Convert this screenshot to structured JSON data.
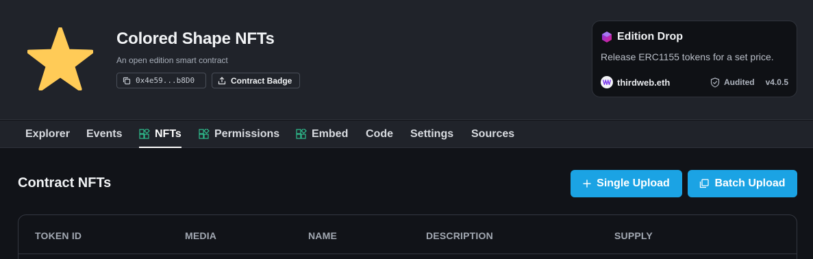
{
  "contract": {
    "name": "Colored Shape NFTs",
    "description": "An open edition smart contract",
    "address": "0x4e59...b8D0",
    "badge_label": "Contract Badge"
  },
  "card": {
    "title": "Edition Drop",
    "description": "Release ERC1155 tokens for a set price.",
    "publisher": "thirdweb.eth",
    "audited_label": "Audited",
    "version": "v4.0.5"
  },
  "tabs": [
    {
      "label": "Explorer",
      "icon": null
    },
    {
      "label": "Events",
      "icon": null
    },
    {
      "label": "NFTs",
      "icon": "extension-icon",
      "active": true
    },
    {
      "label": "Permissions",
      "icon": "extension-icon"
    },
    {
      "label": "Embed",
      "icon": "extension-icon"
    },
    {
      "label": "Code",
      "icon": null
    },
    {
      "label": "Settings",
      "icon": null
    },
    {
      "label": "Sources",
      "icon": null
    }
  ],
  "section": {
    "title": "Contract NFTs",
    "single_upload_label": "Single Upload",
    "batch_upload_label": "Batch Upload"
  },
  "table": {
    "columns": [
      "TOKEN ID",
      "MEDIA",
      "NAME",
      "DESCRIPTION",
      "SUPPLY"
    ]
  },
  "colors": {
    "accent": "#1ba3e4",
    "star": "#ffcb57",
    "extension_icon": "#2fbf8f",
    "brand_gradient_start": "#7c3aed",
    "brand_gradient_end": "#e11d8a"
  }
}
